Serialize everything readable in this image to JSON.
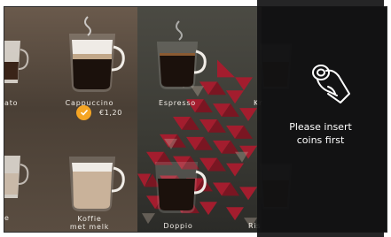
{
  "drinks": {
    "top_left_partial": "ato",
    "cappuccino": "Cappuccino",
    "espresso": "Espresso",
    "top_right_partial": "Kr",
    "bottom_left_partial": "e",
    "koffie_melk_line1": "Koffie",
    "koffie_melk_line2": "met melk",
    "doppio": "Doppio",
    "bottom_right_partial": "Ris"
  },
  "selection": {
    "price": "€1,20",
    "check_icon": "check-icon"
  },
  "payment": {
    "message_line1": "Please insert",
    "message_line2": "coins first",
    "icon": "coin-insert-icon"
  },
  "colors": {
    "accent": "#f5a524",
    "pattern_red": "#a31d2e"
  }
}
